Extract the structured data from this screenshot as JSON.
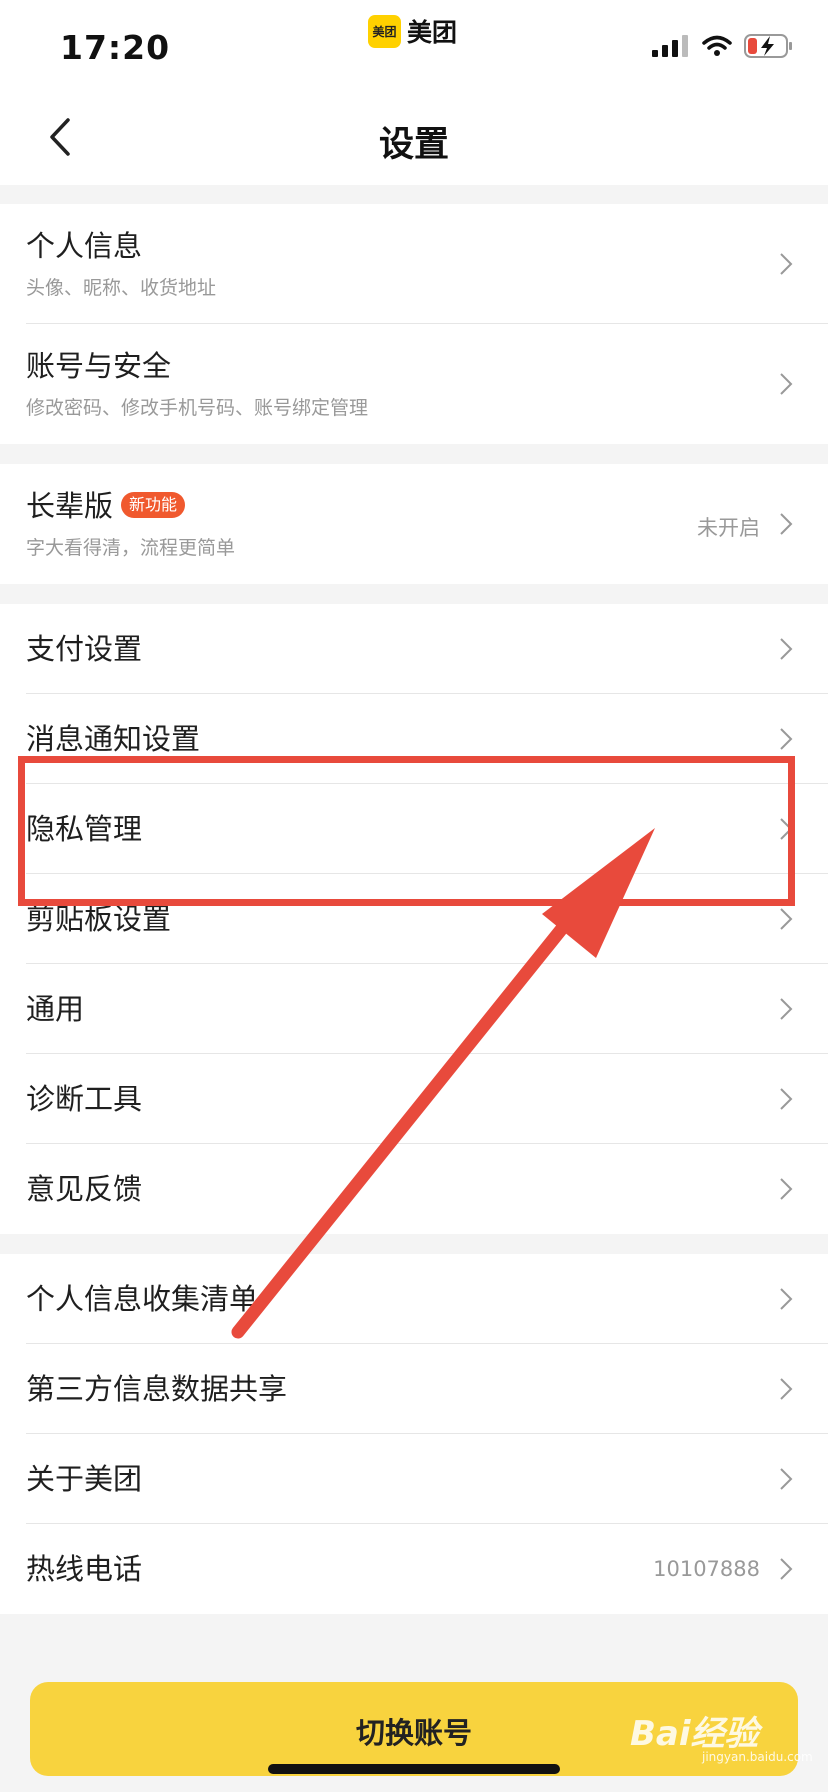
{
  "status_bar": {
    "time": "17:20",
    "app_logo": "美团",
    "app_name": "美团"
  },
  "header": {
    "title": "设置"
  },
  "groups": [
    {
      "items": [
        {
          "label": "个人信息",
          "subtitle": "头像、昵称、收货地址"
        },
        {
          "label": "账号与安全",
          "subtitle": "修改密码、修改手机号码、账号绑定管理"
        }
      ]
    },
    {
      "items": [
        {
          "label": "长辈版",
          "badge": "新功能",
          "subtitle": "字大看得清，流程更简单",
          "value": "未开启"
        }
      ]
    },
    {
      "items": [
        {
          "label": "支付设置"
        },
        {
          "label": "消息通知设置"
        },
        {
          "label": "隐私管理"
        },
        {
          "label": "剪贴板设置"
        },
        {
          "label": "通用"
        },
        {
          "label": "诊断工具"
        },
        {
          "label": "意见反馈"
        }
      ]
    },
    {
      "items": [
        {
          "label": "个人信息收集清单"
        },
        {
          "label": "第三方信息数据共享"
        },
        {
          "label": "关于美团"
        },
        {
          "label": "热线电话",
          "value": "10107888"
        }
      ]
    }
  ],
  "footer": {
    "switch_account_label": "切换账号"
  },
  "watermark": {
    "text": "Bai经验",
    "sub": "jingyan.baidu.com"
  },
  "colors": {
    "accent": "#f8d33e",
    "badge": "#f0592e",
    "annotation": "#e84a3c"
  }
}
